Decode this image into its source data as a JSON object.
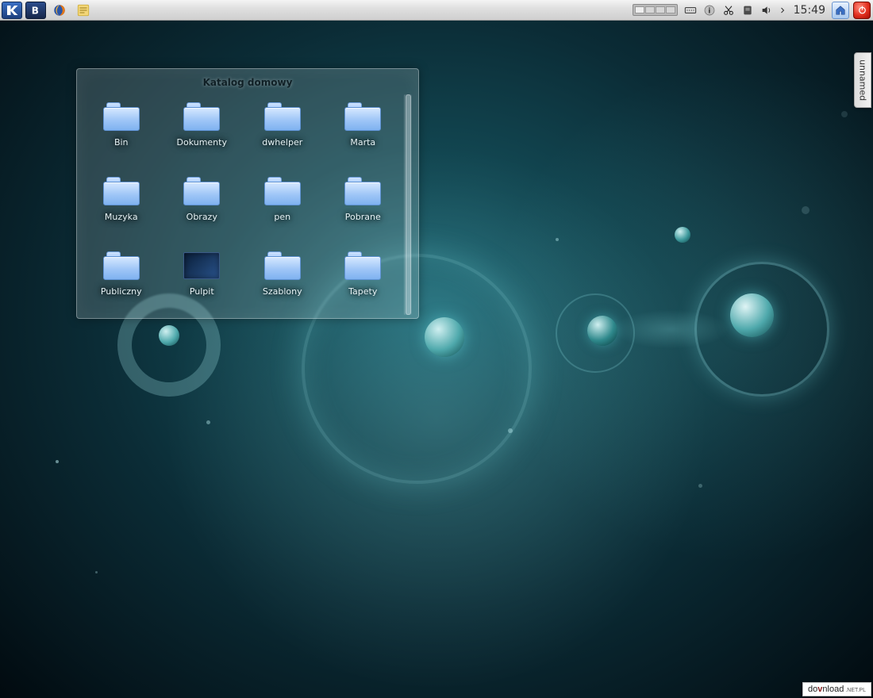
{
  "panel": {
    "clock": "15:49"
  },
  "side_tab": {
    "label": "unnamed"
  },
  "folder_widget": {
    "title": "Katalog domowy",
    "items": [
      {
        "label": "Bin",
        "type": "folder"
      },
      {
        "label": "Dokumenty",
        "type": "folder"
      },
      {
        "label": "dwhelper",
        "type": "folder"
      },
      {
        "label": "Marta",
        "type": "folder"
      },
      {
        "label": "Muzyka",
        "type": "folder"
      },
      {
        "label": "Obrazy",
        "type": "folder"
      },
      {
        "label": "pen",
        "type": "folder"
      },
      {
        "label": "Pobrane",
        "type": "folder"
      },
      {
        "label": "Publiczny",
        "type": "folder"
      },
      {
        "label": "Pulpit",
        "type": "thumb"
      },
      {
        "label": "Szablony",
        "type": "folder"
      },
      {
        "label": "Tapety",
        "type": "folder"
      }
    ]
  },
  "watermark": {
    "pre": "do",
    "mid": "v",
    "post": "nload",
    "suffix": ".NET.PL"
  }
}
